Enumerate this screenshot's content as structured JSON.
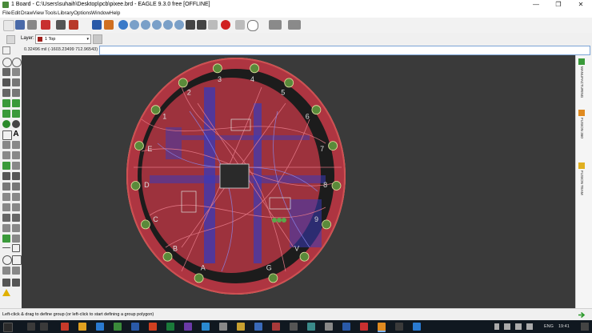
{
  "window": {
    "title": "1 Board - C:\\Users\\suhaih\\Desktop\\pcb\\pixee.brd - EAGLE 9.3.0 free [OFFLINE]",
    "controls": {
      "minimize": "—",
      "maximize": "❐",
      "close": "✕"
    }
  },
  "menu": {
    "items": [
      "File",
      "Edit",
      "Draw",
      "View",
      "Tools",
      "Library",
      "Options",
      "Window",
      "Help"
    ]
  },
  "layerbar": {
    "label": "Layer:",
    "selected": "1 Top",
    "selected_color": "#a0201c"
  },
  "command": {
    "coordinates": "0.32496 mil (-1603.23499 712.96543)",
    "input_value": ""
  },
  "status": {
    "text": "Left-click & drag to define group (or left-click to start defining a group polygon)"
  },
  "right_panel": {
    "tabs": [
      "MANUFACTURING",
      "FUSION 360",
      "FUSION TEAM"
    ]
  },
  "taskbar": {
    "language": "ENG",
    "time": "19:41"
  },
  "colors": {
    "canvas": "#3a3a3a",
    "board_outline": "#f0c890",
    "top_copper": "#c83a48",
    "bottom_copper": "#3a3ab8",
    "pads": "#5a8a3a",
    "silkscreen": "#dcdcdc"
  },
  "board": {
    "edge_pad_labels": [
      "A",
      "B",
      "C",
      "D",
      "E",
      "1",
      "2",
      "3",
      "4",
      "5",
      "6",
      "7",
      "8",
      "9",
      "V",
      "G"
    ]
  },
  "icons": {
    "toolbar": [
      "open-icon",
      "save-icon",
      "print-icon",
      "cam-icon",
      "schematic-icon",
      "board-icon",
      "zoom-fit-icon",
      "zoom-in-icon",
      "zoom-out-icon",
      "zoom-select-icon",
      "undo-icon",
      "redo-icon",
      "stop-icon",
      "help-icon"
    ],
    "left_tools": [
      "info-icon",
      "show-icon",
      "move-icon",
      "copy-icon",
      "rotate-icon",
      "mirror-icon",
      "route-icon",
      "ripup-icon",
      "via-icon",
      "text-icon",
      "polygon-icon",
      "delete-icon",
      "wire-icon",
      "circle-icon",
      "drc-icon",
      "error-icon"
    ]
  }
}
